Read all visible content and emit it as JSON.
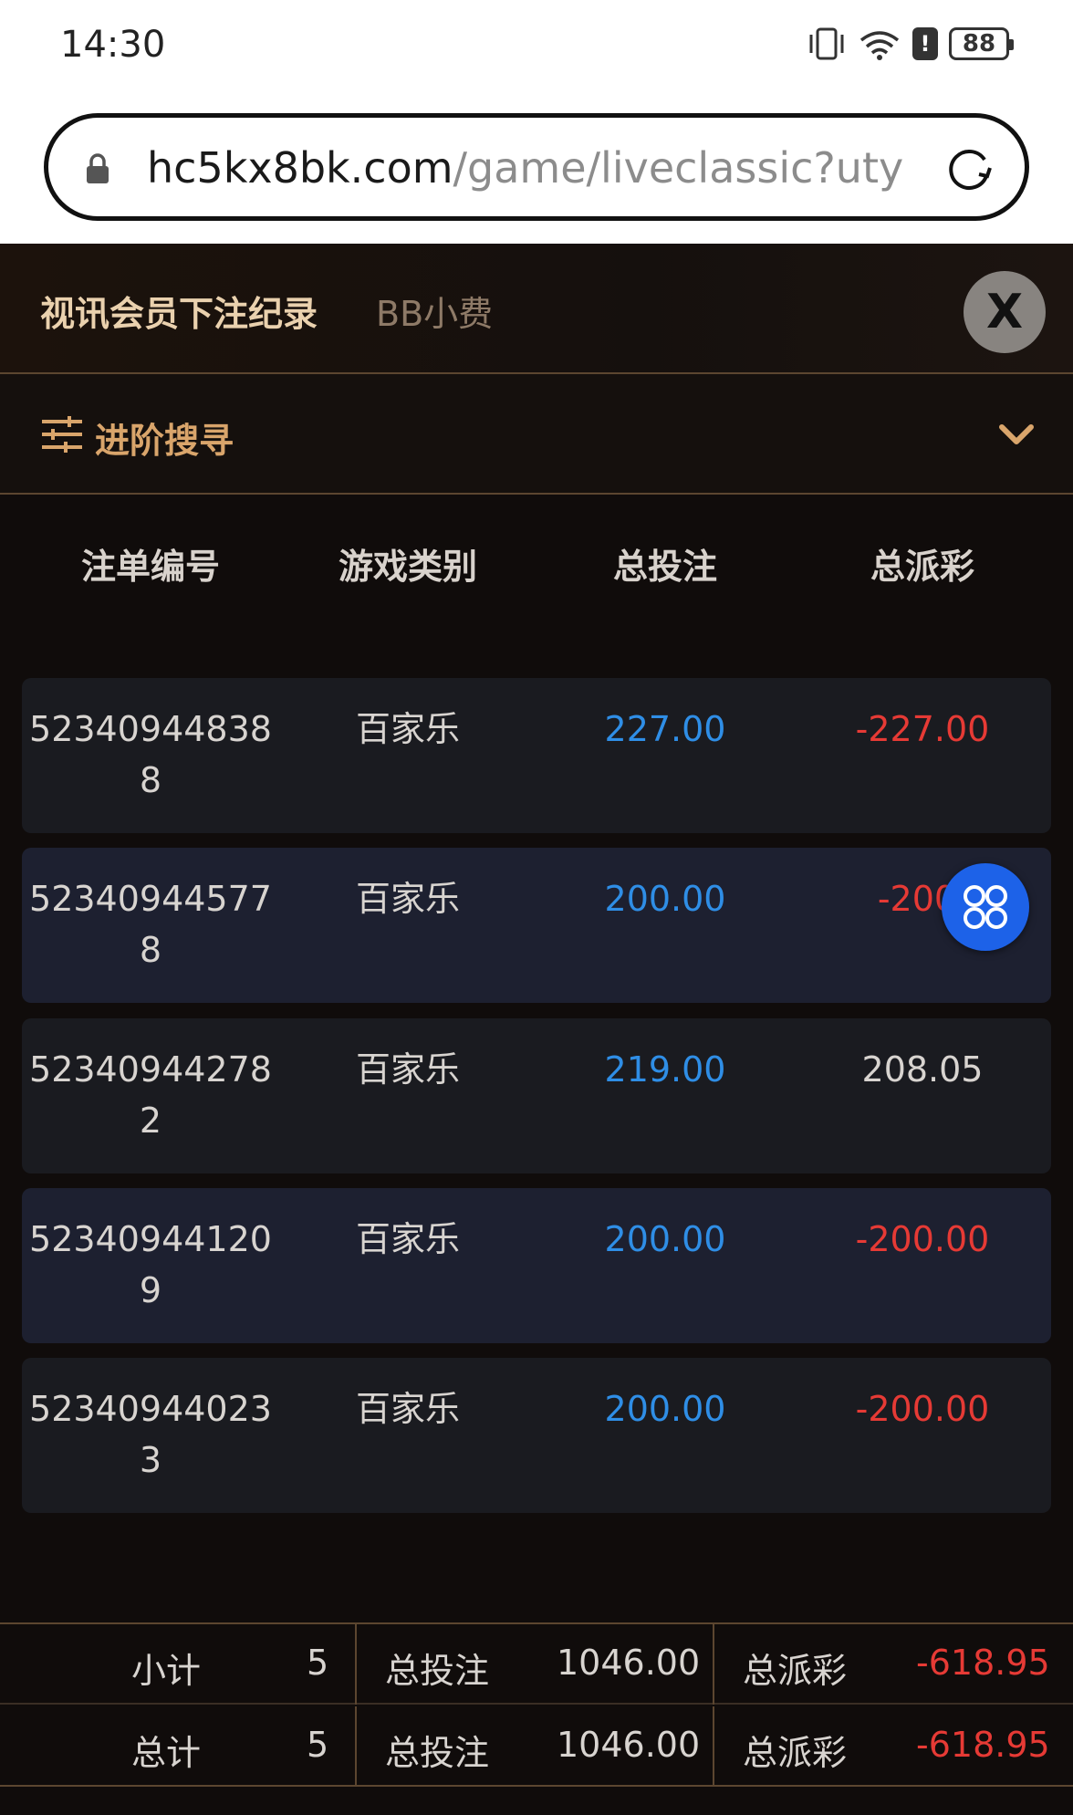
{
  "status_bar": {
    "time": "14:30",
    "battery": "88"
  },
  "browser": {
    "url_domain": "hc5kx8bk.com",
    "url_path": "/game/liveclassic?utype"
  },
  "header": {
    "tabs": [
      {
        "label": "视讯会员下注纪录"
      },
      {
        "label": "BB小费"
      }
    ],
    "close_label": "X"
  },
  "advanced_search": {
    "label": "进阶搜寻"
  },
  "table": {
    "columns": [
      "注单编号",
      "游戏类别",
      "总投注",
      "总派彩"
    ],
    "rows": [
      {
        "id_line1": "52340944838",
        "id_line2": "8",
        "game": "百家乐",
        "bet": "227.00",
        "payout": "-227.00"
      },
      {
        "id_line1": "52340944577",
        "id_line2": "8",
        "game": "百家乐",
        "bet": "200.00",
        "payout": "-200."
      },
      {
        "id_line1": "52340944278",
        "id_line2": "2",
        "game": "百家乐",
        "bet": "219.00",
        "payout": "208.05"
      },
      {
        "id_line1": "52340944120",
        "id_line2": "9",
        "game": "百家乐",
        "bet": "200.00",
        "payout": "-200.00"
      },
      {
        "id_line1": "52340944023",
        "id_line2": "3",
        "game": "百家乐",
        "bet": "200.00",
        "payout": "-200.00"
      }
    ]
  },
  "summary": {
    "subtotal": {
      "label": "小计",
      "count": "5",
      "bet_label": "总投注",
      "bet": "1046.00",
      "payout_label": "总派彩",
      "payout": "-618.95"
    },
    "total": {
      "label": "总计",
      "count": "5",
      "bet_label": "总投注",
      "bet": "1046.00",
      "payout_label": "总派彩",
      "payout": "-618.95"
    }
  },
  "colors": {
    "accent_gold": "#d9a56b",
    "bet_blue": "#2f8ee6",
    "negative_red": "#e63a35",
    "fab_blue": "#1d62e8"
  }
}
